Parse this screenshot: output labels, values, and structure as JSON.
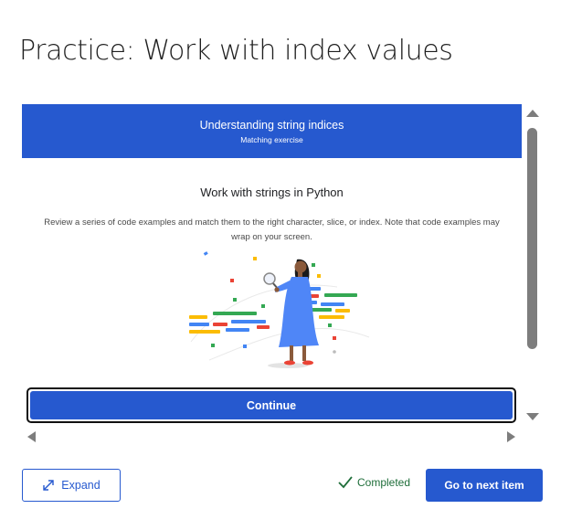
{
  "page": {
    "title": "Practice: Work with index values"
  },
  "activity": {
    "header_title": "Understanding string indices",
    "header_subtitle": "Matching exercise",
    "heading": "Work with strings in Python",
    "description": "Review a series of code examples and match them to the right character, slice, or index. Note that code examples may wrap on your screen.",
    "continue_label": "Continue",
    "illustration_icon": "woman-with-magnifying-glass-and-code-lines"
  },
  "footer": {
    "expand_label": "Expand",
    "completed_label": "Completed",
    "next_label": "Go to next item"
  },
  "colors": {
    "primary": "#2659cf",
    "completed": "#1f6e3a",
    "scrollbar": "#7d7d7d",
    "code_blue": "#4285f4",
    "code_green": "#34a853",
    "code_yellow": "#fbbc04",
    "code_red": "#ea4335"
  }
}
